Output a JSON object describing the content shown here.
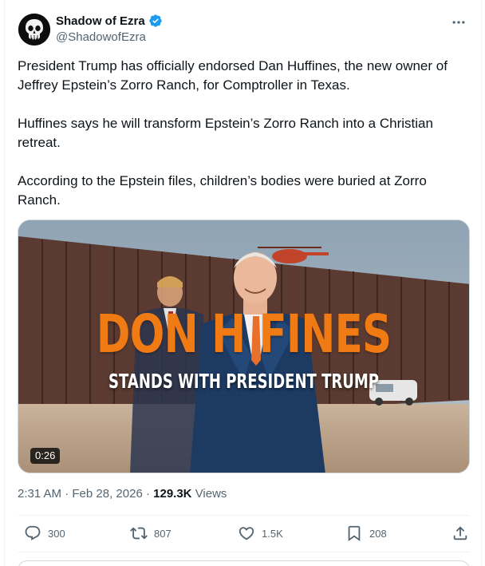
{
  "author": {
    "display_name": "Shadow of Ezra",
    "handle": "@ShadowofEzra",
    "verified": true,
    "verified_color": "#1d9bf0"
  },
  "tweet": {
    "paragraphs": [
      "President Trump has officially endorsed Dan Huffines, the new owner of Jeffrey Epstein’s Zorro Ranch, for Comptroller in Texas.",
      "Huffines says he will transform Epstein’s Zorro Ranch into a Christian retreat.",
      "According to the Epstein files, children’s bodies were buried at Zorro Ranch."
    ]
  },
  "media": {
    "overlay_title": "DON H   FINES",
    "overlay_subtitle": "STANDS WITH PRESIDENT TRUMP",
    "duration": "0:26",
    "title_color": "#f07a14"
  },
  "meta": {
    "time": "2:31 AM",
    "date": "Feb 28, 2026",
    "separator": "·",
    "views_count": "129.3K",
    "views_label": "Views"
  },
  "actions": {
    "replies": "300",
    "reposts": "807",
    "likes": "1.5K",
    "bookmarks": "208"
  },
  "icons": {
    "avatar": "punisher-skull-icon",
    "more": "more-horizontal-icon",
    "reply": "reply-icon",
    "repost": "repost-icon",
    "like": "heart-icon",
    "bookmark": "bookmark-icon",
    "share": "share-icon"
  }
}
